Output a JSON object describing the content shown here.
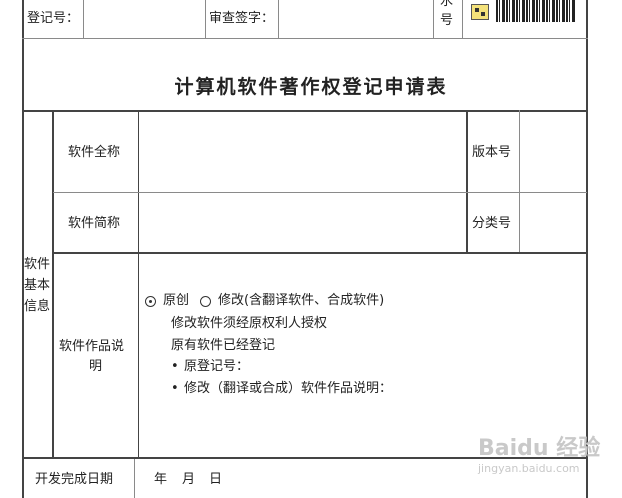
{
  "header": {
    "reg_no_label": "登记号：",
    "review_sign_label": "审查签字：",
    "serial_label_line1": "水",
    "serial_label_line2": "号"
  },
  "form": {
    "title": "计算机软件著作权登记申请表",
    "section_label_lines": [
      "软件",
      "基本",
      "信息"
    ],
    "full_name_label": "软件全称",
    "version_label": "版本号",
    "short_name_label": "软件简称",
    "category_label": "分类号",
    "work_desc_label_line1": "软件作品说",
    "work_desc_label_line2": "明",
    "option_original": "原创",
    "option_modified": "修改(含翻译软件、合成软件)",
    "note_authorized": "修改软件须经原权利人授权",
    "note_registered": "原有软件已经登记",
    "bullet_orig_reg_no": "原登记号：",
    "bullet_mod_desc": "修改（翻译或合成）软件作品说明：",
    "dev_date_label": "开发完成日期",
    "year_label": "年",
    "month_label": "月",
    "day_label": "日"
  },
  "watermark": {
    "brand": "Baidu 经验",
    "url": "jingyan.baidu.com"
  },
  "icons": [
    "qr-code-icon",
    "barcode-icon",
    "radio-selected-icon",
    "radio-empty-icon",
    "bullet-icon"
  ]
}
